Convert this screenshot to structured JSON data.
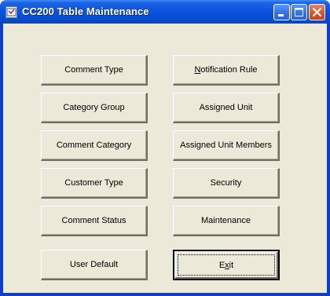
{
  "window": {
    "title": "CC200 Table Maintenance"
  },
  "buttons": {
    "comment_type": "Comment Type",
    "category_group": "Category Group",
    "comment_category": "Comment Category",
    "customer_type": "Customer Type",
    "comment_status": "Comment Status",
    "user_default": "User Default",
    "notification_rule": {
      "mnemonic": "N",
      "rest": "otification Rule"
    },
    "assigned_unit": "Assigned Unit",
    "assigned_unit_members": "Assigned Unit Members",
    "security": "Security",
    "maintenance": "Maintenance",
    "exit": {
      "prefix": "E",
      "mnemonic": "x",
      "rest": "it"
    }
  }
}
